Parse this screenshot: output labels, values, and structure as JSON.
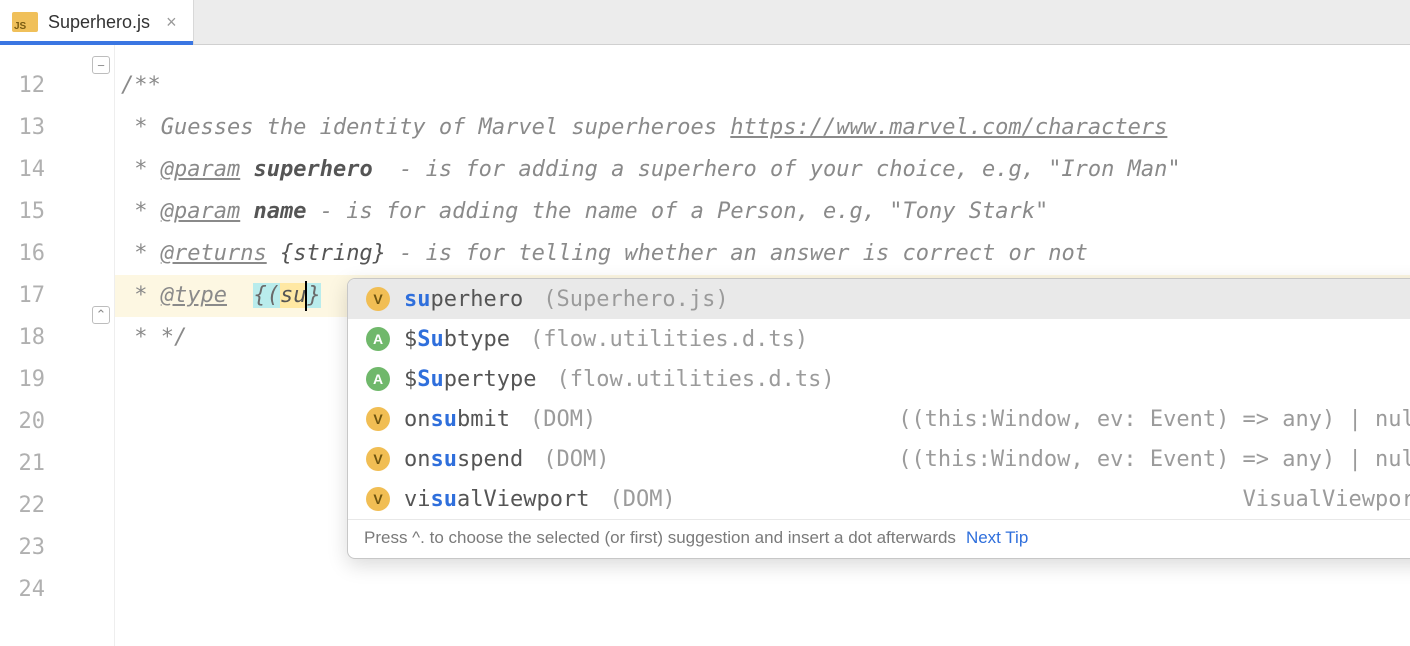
{
  "tab": {
    "filename": "Superhero.js",
    "close_glyph": "×"
  },
  "gutter": {
    "start": 12,
    "count": 13
  },
  "code": {
    "l12": "/**",
    "l13_a": " * Guesses the identity of Marvel superheroes ",
    "l13_link": "https://www.marvel.com/characters",
    "l14_a": " * ",
    "l14_tag": "@param",
    "l14_name": " superhero",
    "l14_b": "  - is for adding a superhero of your choice, e.g, \"Iron Man\"",
    "l15_a": " * ",
    "l15_tag": "@param",
    "l15_name": " name",
    "l15_b": " - is for adding the name of a Person, e.g, \"Tony Stark\"",
    "l16_a": " * ",
    "l16_tag": "@returns",
    "l16_type": " {string}",
    "l16_b": " - is for telling whether an answer is correct or not",
    "l17_a": " * ",
    "l17_tag": "@type",
    "l17_b": "  ",
    "l17_brace_open": "{(",
    "l17_typed": "su",
    "l17_brace_close": "}",
    "l18": " * */"
  },
  "popup": {
    "items": [
      {
        "kind": "v",
        "prefix": "",
        "match": "su",
        "rest": "perhero",
        "source": "(Superhero.js)",
        "right": ""
      },
      {
        "kind": "a",
        "prefix": "$",
        "match": "Su",
        "rest": "btype",
        "source": "(flow.utilities.d.ts)",
        "right": ""
      },
      {
        "kind": "a",
        "prefix": "$",
        "match": "Su",
        "rest": "pertype",
        "source": "(flow.utilities.d.ts)",
        "right": ""
      },
      {
        "kind": "v",
        "prefix": "on",
        "match": "su",
        "rest": "bmit",
        "source": "(DOM)",
        "right": "((this:Window, ev: Event) => any) | null"
      },
      {
        "kind": "v",
        "prefix": "on",
        "match": "su",
        "rest": "spend",
        "source": "(DOM)",
        "right": "((this:Window, ev: Event) => any) | null"
      },
      {
        "kind": "v",
        "prefix": "vi",
        "match": "su",
        "rest": "alViewport",
        "source": "(DOM)",
        "right": "VisualViewport"
      }
    ],
    "footer_text": "Press ^. to choose the selected (or first) suggestion and insert a dot afterwards",
    "footer_tip": "Next Tip",
    "more_glyph": "⋮"
  }
}
